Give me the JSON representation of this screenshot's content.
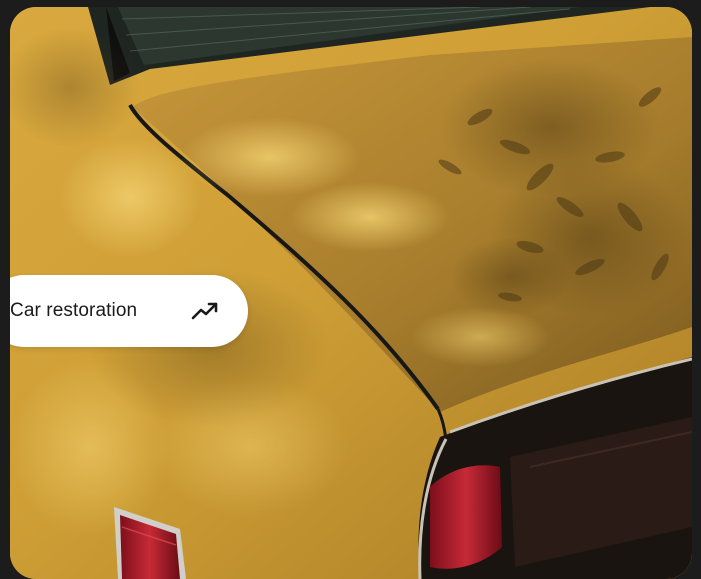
{
  "card": {
    "tag": {
      "label": "Car restoration",
      "icon": "trending-up-icon"
    },
    "image": {
      "subject": "mustard-yellow-vintage-car-rear"
    }
  },
  "colors": {
    "paint": "#d1a23a",
    "paint_shadow": "#6e5420",
    "trim": "#141414",
    "taillight": "#a3192a",
    "pill": "#ffffff",
    "text": "#1a1a1a"
  }
}
